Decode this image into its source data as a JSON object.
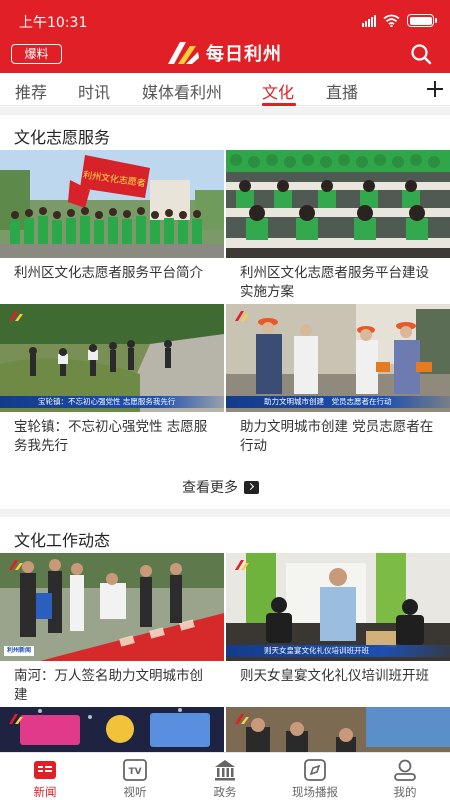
{
  "status_bar": {
    "time": "上午10:31"
  },
  "header": {
    "report_label": "爆料",
    "app_title": "每日利州",
    "accent_color": "#e02026"
  },
  "tabs": [
    {
      "label": "推荐",
      "active": false
    },
    {
      "label": "时讯",
      "active": false
    },
    {
      "label": "媒体看利州",
      "active": false
    },
    {
      "label": "文化",
      "active": true
    },
    {
      "label": "直播",
      "active": false
    }
  ],
  "sections": [
    {
      "title": "文化志愿服务",
      "cards": [
        {
          "title": "利州区文化志愿者服务平台简介"
        },
        {
          "title": "利州区文化志愿者服务平台建设实施方案"
        },
        {
          "title": "宝轮镇：不忘初心强党性 志愿服务我先行",
          "caption": "宝轮镇：不忘初心强党性 志愿服务我先行"
        },
        {
          "title": "助力文明城市创建 党员志愿者在行动",
          "caption": "助力文明城市创建　党员志愿者在行动"
        }
      ],
      "see_more": "查看更多"
    },
    {
      "title": "文化工作动态",
      "cards": [
        {
          "title": "南河：万人签名助力文明城市创建"
        },
        {
          "title": "则天女皇宴文化礼仪培训班开班",
          "caption": "则天女皇宴文化礼仪培训班开班"
        },
        {
          "title": ""
        },
        {
          "title": ""
        }
      ]
    }
  ],
  "banner_text": "利州文化志愿者",
  "caption_logo": "利州新闻",
  "bottom_nav": [
    {
      "label": "新闻",
      "icon": "news-icon",
      "active": true
    },
    {
      "label": "视听",
      "icon": "tv-icon",
      "active": false
    },
    {
      "label": "政务",
      "icon": "government-building-icon",
      "active": false
    },
    {
      "label": "现场播报",
      "icon": "live-report-icon",
      "active": false
    },
    {
      "label": "我的",
      "icon": "user-profile-icon",
      "active": false
    }
  ]
}
